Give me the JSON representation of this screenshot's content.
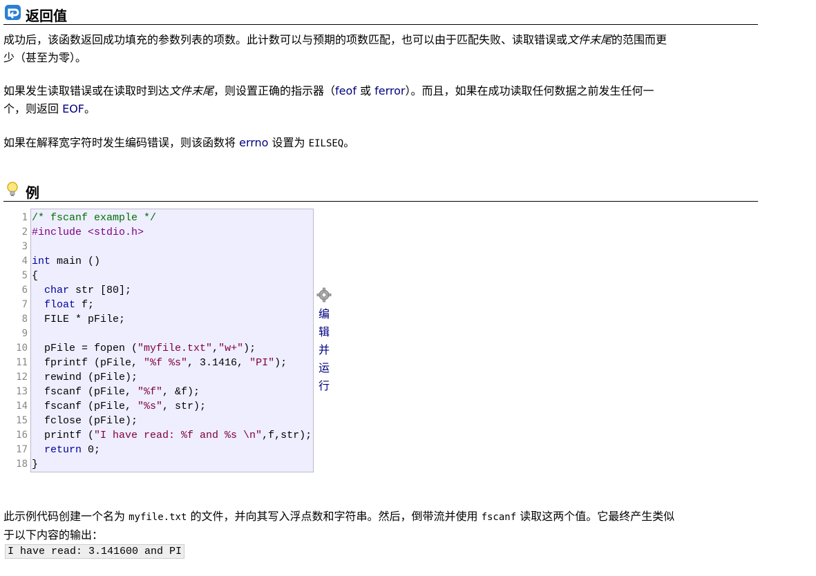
{
  "return_section": {
    "heading": "返回值",
    "p1_a": "成功后，该函数返回成功填充的参数列表的项数。此计数可以与预期的项数匹配，也可以由于匹配失败、读取错误或",
    "p1_em": "文件末尾",
    "p1_b": "的范围而更",
    "p1_line2": "少（甚至为零）。",
    "p2_a": "如果发生读取错误或在读取时到达",
    "p2_em": "文件末尾",
    "p2_b": "，则设置正确的指示器（",
    "p2_feof": "feof",
    "p2_or": " 或 ",
    "p2_ferror": "ferror",
    "p2_c": "）。而且，如果在成功读取任何数据之前发生任何一",
    "p2_line2_a": "个，则返回 ",
    "p2_eof": "EOF",
    "p2_line2_b": "。",
    "p3_a": "如果在解释宽字符时发生编码错误，则该函数将 ",
    "p3_errno": "errno",
    "p3_b": " 设置为 ",
    "p3_eilseq": "EILSEQ",
    "p3_c": "。"
  },
  "example_section": {
    "heading": "例",
    "run_label": [
      "编",
      "辑",
      "并",
      "运",
      "行"
    ],
    "line_numbers": [
      "1",
      "2",
      "3",
      "4",
      "5",
      "6",
      "7",
      "8",
      "9",
      "10",
      "11",
      "12",
      "13",
      "14",
      "15",
      "16",
      "17",
      "18"
    ],
    "code": [
      "/* fscanf example */",
      "#include <stdio.h>",
      "",
      "int main ()",
      "{",
      "  char str [80];",
      "  float f;",
      "  FILE * pFile;",
      "",
      "  pFile = fopen (\"myfile.txt\",\"w+\");",
      "  fprintf (pFile, \"%f %s\", 3.1416, \"PI\");",
      "  rewind (pFile);",
      "  fscanf (pFile, \"%f\", &f);",
      "  fscanf (pFile, \"%s\", str);",
      "  fclose (pFile);",
      "  printf (\"I have read: %f and %s \\n\",f,str);",
      "  return 0;",
      "}"
    ],
    "desc_a": "此示例代码创建一个名为 ",
    "desc_file": "myfile.txt",
    "desc_b": " 的文件，并向其写入浮点数和字符串。然后，倒带流并使用 ",
    "desc_func": "fscanf",
    "desc_c": " 读取这两个值。它最终产生类似",
    "desc_line2": "于以下内容的输出：",
    "output": "I have read: 3.141600 and PI"
  },
  "colors": {
    "link": "#000080",
    "code_bg": "#eeeeff",
    "comment": "#007000",
    "preprocessor": "#800080",
    "keyword": "#00009a",
    "string": "#800040"
  }
}
